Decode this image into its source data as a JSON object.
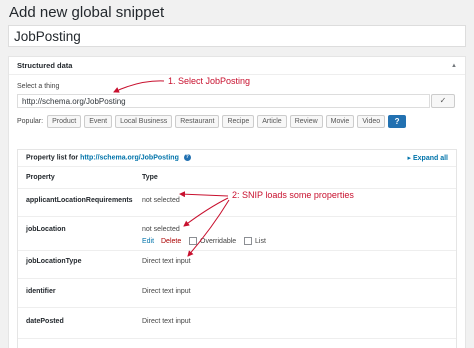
{
  "page": {
    "title": "Add new global snippet",
    "snippet_title_value": "JobPosting"
  },
  "structured_data": {
    "panel_title": "Structured data",
    "select_label": "Select a thing",
    "thing_value": "http://schema.org/JobPosting",
    "apply_icon": "checkmark-icon",
    "popular_label": "Popular:",
    "popular": [
      "Product",
      "Event",
      "Local Business",
      "Restaurant",
      "Recipe",
      "Article",
      "Review",
      "Movie",
      "Video"
    ],
    "help_label": "?"
  },
  "property_list": {
    "title_prefix": "Property list for",
    "title_link": "http://schema.org/JobPosting",
    "expand_label": "Expand all",
    "col_property": "Property",
    "col_type": "Type",
    "rows": [
      {
        "name": "applicantLocationRequirements",
        "type": "not selected"
      },
      {
        "name": "jobLocation",
        "type": "not selected",
        "edit": "Edit",
        "delete": "Delete",
        "overridable": "Overridable",
        "list": "List"
      },
      {
        "name": "jobLocationType",
        "type": "Direct text input"
      },
      {
        "name": "identifier",
        "type": "Direct text input"
      },
      {
        "name": "datePosted",
        "type": "Direct text input"
      }
    ]
  },
  "annotations": {
    "first": "1. Select JobPosting",
    "second": "2: SNIP loads some properties",
    "color": "#c8102e"
  }
}
